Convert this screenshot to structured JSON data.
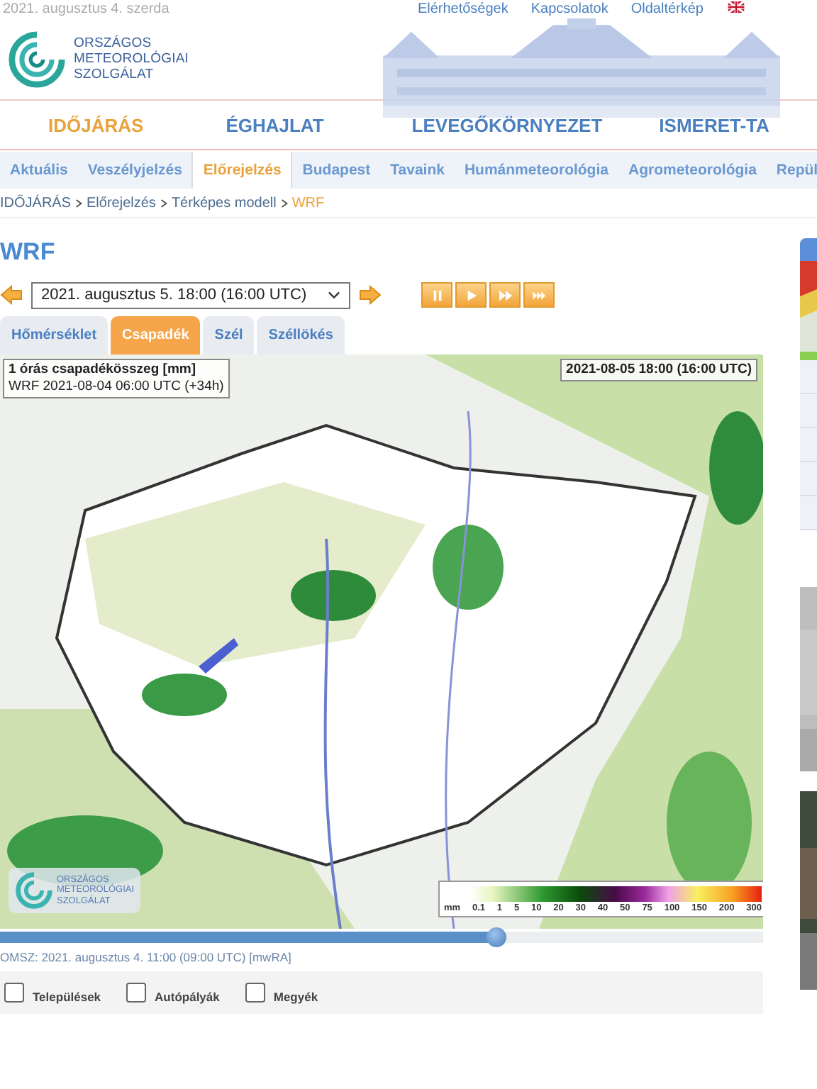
{
  "top_bar": {
    "date": "2021. augusztus 4. szerda",
    "links": [
      "Elérhetőségek",
      "Kapcsolatok",
      "Oldaltérkép"
    ]
  },
  "logo": {
    "lines": [
      "ORSZÁGOS",
      "METEOROLÓGIAI",
      "SZOLGÁLAT"
    ]
  },
  "main_nav": [
    {
      "label": "IDŐJÁRÁS",
      "selected": true
    },
    {
      "label": "ÉGHAJLAT",
      "selected": false
    },
    {
      "label": "LEVEGŐKÖRNYEZET",
      "selected": false
    },
    {
      "label": "ISMERET-TA",
      "selected": false
    }
  ],
  "sub_nav": [
    {
      "label": "Aktuális",
      "selected": false
    },
    {
      "label": "Veszélyjelzés",
      "selected": false
    },
    {
      "label": "Előrejelzés",
      "selected": true
    },
    {
      "label": "Budapest",
      "selected": false
    },
    {
      "label": "Tavaink",
      "selected": false
    },
    {
      "label": "Humánmeteorológia",
      "selected": false
    },
    {
      "label": "Agrometeorológia",
      "selected": false
    },
    {
      "label": "Repül",
      "selected": false
    }
  ],
  "breadcrumb": [
    {
      "label": "IDŐJÁRÁS",
      "current": false
    },
    {
      "label": "Előrejelzés",
      "current": false
    },
    {
      "label": "Térképes modell",
      "current": false
    },
    {
      "label": "WRF",
      "current": true
    }
  ],
  "heading": "WRF",
  "time_select": {
    "value": "2021. augusztus 5. 18:00 (16:00  UTC)"
  },
  "tabs": [
    {
      "label": "Hőmérséklet",
      "selected": false
    },
    {
      "label": "Csapadék",
      "selected": true
    },
    {
      "label": "Szél",
      "selected": false
    },
    {
      "label": "Széllökés",
      "selected": false
    }
  ],
  "map": {
    "title": "1 órás csapadékösszeg [mm]",
    "model": "WRF 2021-08-04 06:00 UTC (+34h)",
    "valid_time": "2021-08-05 18:00 (16:00 UTC)",
    "logo_lines": [
      "ORSZÁGOS",
      "METEOROLÓGIAI",
      "SZOLGÁLAT"
    ],
    "legend": {
      "unit": "mm",
      "ticks": [
        "0.1",
        "1",
        "5",
        "10",
        "20",
        "30",
        "40",
        "50",
        "75",
        "100",
        "150",
        "200",
        "300"
      ]
    }
  },
  "timeline": {
    "level": 0.65
  },
  "source": {
    "text": "OMSZ: 2021. augusztus 4. 11:00 (09:00  UTC)",
    "link": "[mwRA]"
  },
  "layers": [
    {
      "label": "Települések",
      "checked": false
    },
    {
      "label": "Autópályák",
      "checked": false
    },
    {
      "label": "Megyék",
      "checked": false
    }
  ]
}
